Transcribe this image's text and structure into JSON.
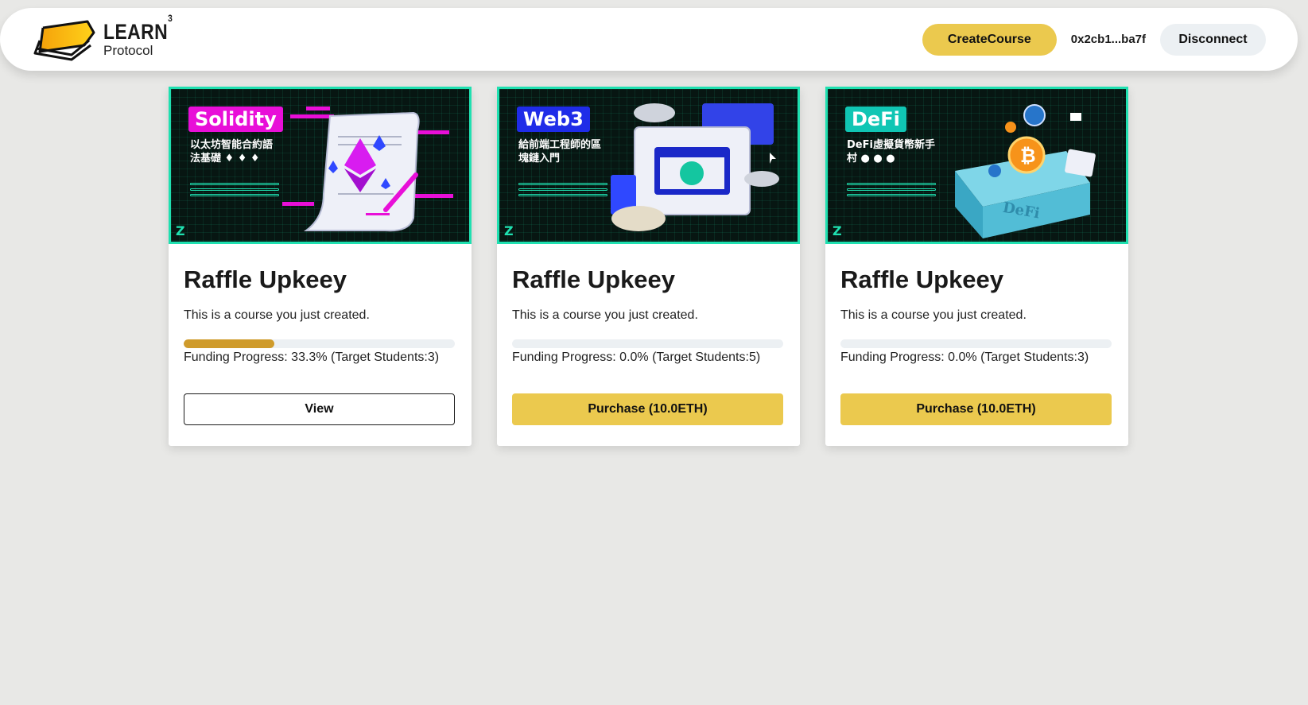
{
  "header": {
    "brand_title": "LEARN",
    "brand_sup": "3",
    "brand_subtitle": "Protocol",
    "create_label": "CreateCourse",
    "wallet": "0x2cb1...ba7f",
    "disconnect_label": "Disconnect"
  },
  "colors": {
    "accent": "#ebc94e",
    "progress": "#cf9b2b",
    "thumb_border": "#1fe0b0"
  },
  "courses": [
    {
      "thumb_tag": "Solidity",
      "thumb_text": "以太坊智能合約語法基礎 ♦ ♦ ♦",
      "thumb_logo": "Z",
      "title": "Raffle Upkeey",
      "description": "This is a course you just created.",
      "progress_fraction": 0.333,
      "progress_text": "Funding Progress: 33.3% (Target Students:3)",
      "action_label": "View"
    },
    {
      "thumb_tag": "Web3",
      "thumb_text": "給前端工程師的區塊鏈入門",
      "thumb_logo": "Z",
      "title": "Raffle Upkeey",
      "description": "This is a course you just created.",
      "progress_fraction": 0.0,
      "progress_text": "Funding Progress: 0.0% (Target Students:5)",
      "action_label": "Purchase (10.0ETH)"
    },
    {
      "thumb_tag": "DeFi",
      "thumb_text": "DeFi虛擬貨幣新手村 ● ● ●",
      "thumb_logo": "Z",
      "title": "Raffle Upkeey",
      "description": "This is a course you just created.",
      "progress_fraction": 0.0,
      "progress_text": "Funding Progress: 0.0% (Target Students:3)",
      "action_label": "Purchase (10.0ETH)"
    }
  ]
}
